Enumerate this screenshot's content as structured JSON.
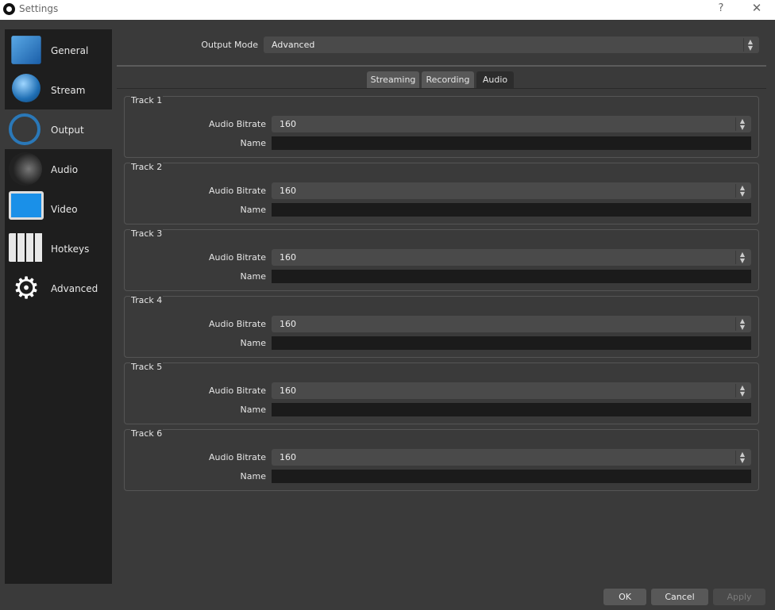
{
  "window": {
    "title": "Settings",
    "help_glyph": "?",
    "close_glyph": "✕"
  },
  "sidebar": {
    "items": [
      {
        "label": "General",
        "icon": "general-icon"
      },
      {
        "label": "Stream",
        "icon": "globe-icon"
      },
      {
        "label": "Output",
        "icon": "broadcast-icon"
      },
      {
        "label": "Audio",
        "icon": "speaker-icon"
      },
      {
        "label": "Video",
        "icon": "monitor-icon"
      },
      {
        "label": "Hotkeys",
        "icon": "keyboard-icon"
      },
      {
        "label": "Advanced",
        "icon": "gears-icon"
      }
    ],
    "active_index": 2
  },
  "output_mode": {
    "label": "Output Mode",
    "value": "Advanced"
  },
  "tabs": [
    {
      "label": "Streaming"
    },
    {
      "label": "Recording"
    },
    {
      "label": "Audio"
    }
  ],
  "active_tab": "Audio",
  "tracks": [
    {
      "title": "Track 1",
      "bitrate_label": "Audio Bitrate",
      "bitrate": "160",
      "name_label": "Name",
      "name": ""
    },
    {
      "title": "Track 2",
      "bitrate_label": "Audio Bitrate",
      "bitrate": "160",
      "name_label": "Name",
      "name": ""
    },
    {
      "title": "Track 3",
      "bitrate_label": "Audio Bitrate",
      "bitrate": "160",
      "name_label": "Name",
      "name": ""
    },
    {
      "title": "Track 4",
      "bitrate_label": "Audio Bitrate",
      "bitrate": "160",
      "name_label": "Name",
      "name": ""
    },
    {
      "title": "Track 5",
      "bitrate_label": "Audio Bitrate",
      "bitrate": "160",
      "name_label": "Name",
      "name": ""
    },
    {
      "title": "Track 6",
      "bitrate_label": "Audio Bitrate",
      "bitrate": "160",
      "name_label": "Name",
      "name": ""
    }
  ],
  "buttons": {
    "ok": "OK",
    "cancel": "Cancel",
    "apply": "Apply"
  },
  "colors": {
    "background": "#3a3a3a",
    "sidebar": "#1e1e1e",
    "field": "#4a4a4a",
    "name_field": "#1b1b1b"
  }
}
